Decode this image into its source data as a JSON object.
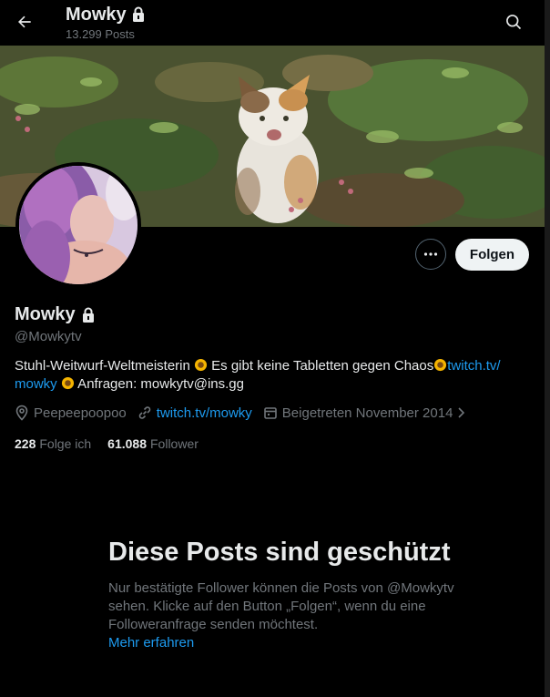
{
  "header": {
    "title": "Mowky",
    "posts_count": "13.299 Posts"
  },
  "profile": {
    "name": "Mowky",
    "handle": "@Mowkytv",
    "bio_part1": "Stuhl-Weitwurf-Weltmeisterin ",
    "bio_part2": " Es gibt keine Tabletten gegen Chaos",
    "bio_link_a": "twitch.tv/",
    "bio_link_b": "mowky",
    "bio_part3": " Anfragen: mowkytv@ins.gg",
    "location": "Peepeepoopoo",
    "website": "twitch.tv/mowky",
    "joined": "Beigetreten November 2014",
    "following_count": "228",
    "following_label": "Folge ich",
    "followers_count": "61.088",
    "followers_label": "Follower"
  },
  "actions": {
    "follow_label": "Folgen"
  },
  "protected": {
    "title": "Diese Posts sind geschützt",
    "text": "Nur bestätigte Follower können die Posts von @Mowkytv sehen. Klicke auf den Button „Folgen“, wenn du eine Followeranfrage senden möchtest.",
    "link": "Mehr erfahren"
  },
  "icons": {
    "back": "arrow-left-icon",
    "lock": "lock-icon",
    "search": "search-icon",
    "more": "more-dots-icon",
    "location": "location-pin-icon",
    "link": "link-icon",
    "calendar": "calendar-icon",
    "chevron": "chevron-right-icon",
    "sunflower": "sunflower-emoji"
  },
  "colors": {
    "background": "#000000",
    "accent": "#1d9bf0",
    "secondary_text": "#71767b",
    "primary_text": "#e7e9ea",
    "follow_button": "#eff3f4"
  }
}
